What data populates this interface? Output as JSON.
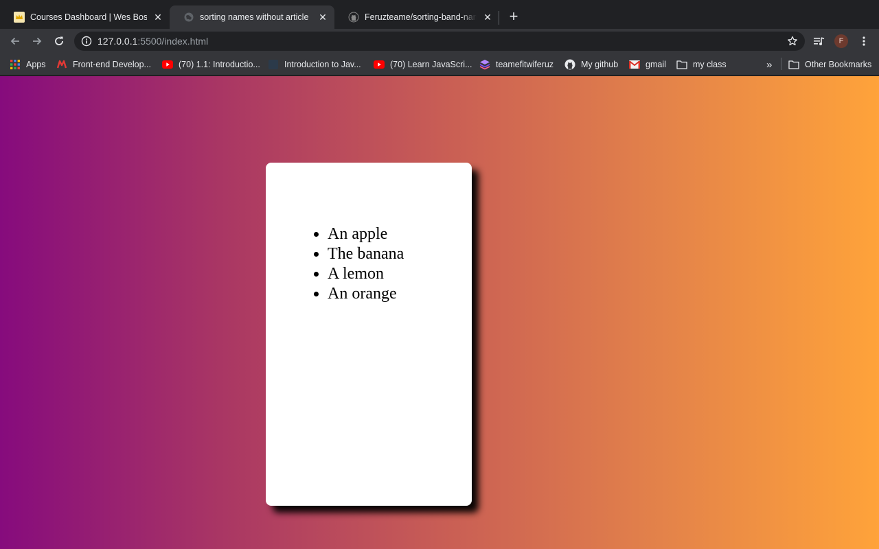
{
  "tabs": [
    {
      "title": "Courses Dashboard | Wes Bos",
      "active": false
    },
    {
      "title": "sorting names without article",
      "active": true
    },
    {
      "title": "Feruzteame/sorting-band-names",
      "active": false
    }
  ],
  "toolbar": {
    "url_host": "127.0.0.1",
    "url_rest": ":5500/index.html",
    "profile_initial": "F"
  },
  "bookmarks": [
    {
      "label": "Apps",
      "icon": "apps-grid-icon"
    },
    {
      "label": "Front-end Develop...",
      "icon": "m-logo-icon"
    },
    {
      "label": "(70) 1.1: Introductio...",
      "icon": "youtube-icon"
    },
    {
      "label": "Introduction to Jav...",
      "icon": "site-icon"
    },
    {
      "label": "(70) Learn JavaScri...",
      "icon": "youtube-icon"
    },
    {
      "label": "teamefitwiferuz",
      "icon": "stack-icon"
    },
    {
      "label": "My github",
      "icon": "github-icon"
    },
    {
      "label": "gmail",
      "icon": "gmail-icon"
    },
    {
      "label": "my class",
      "icon": "folder-icon"
    }
  ],
  "other_bookmarks": "Other Bookmarks",
  "overflow_label": "»",
  "page": {
    "items": [
      "An apple",
      "The banana",
      "A lemon",
      "An orange"
    ]
  },
  "colors": {
    "gradient_start": "#860b7d",
    "gradient_end": "#ffa33a",
    "card": "#ffffff"
  }
}
